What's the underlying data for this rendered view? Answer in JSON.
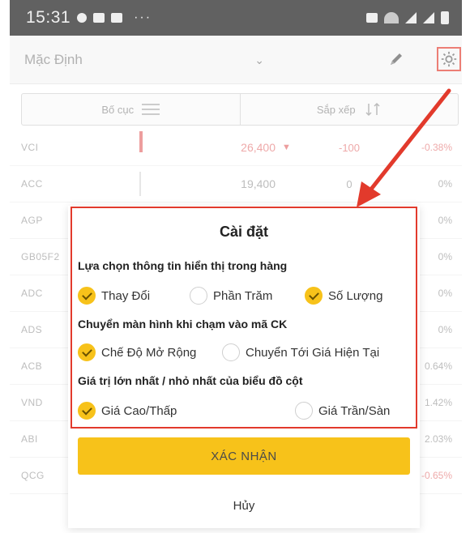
{
  "status_bar": {
    "time": "15:31",
    "more": "···"
  },
  "topbar": {
    "watchlist_value": "Mặc Định"
  },
  "segment": {
    "layout_label": "Bố cục",
    "sort_label": "Sắp xếp"
  },
  "stocks": [
    {
      "symbol": "VCI",
      "price": "26,400",
      "change": "-100",
      "pct": "-0.38%",
      "dir": "down"
    },
    {
      "symbol": "ACC",
      "price": "19,400",
      "change": "0",
      "pct": "0%",
      "dir": "flat"
    },
    {
      "symbol": "AGP",
      "price": "",
      "change": "",
      "pct": "0%",
      "dir": "flat"
    },
    {
      "symbol": "GB05F2",
      "price": "",
      "change": "",
      "pct": "0%",
      "dir": "flat"
    },
    {
      "symbol": "ADC",
      "price": "",
      "change": "",
      "pct": "0%",
      "dir": "flat"
    },
    {
      "symbol": "ADS",
      "price": "",
      "change": "",
      "pct": "0%",
      "dir": "flat"
    },
    {
      "symbol": "ACB",
      "price": "",
      "change": "",
      "pct": "0.64%",
      "dir": "flat"
    },
    {
      "symbol": "VND",
      "price": "",
      "change": "",
      "pct": "1.42%",
      "dir": "flat"
    },
    {
      "symbol": "ABI",
      "price": "",
      "change": "",
      "pct": "2.03%",
      "dir": "flat"
    },
    {
      "symbol": "QCG",
      "price": "",
      "change": "",
      "pct": "-0.65%",
      "dir": "down"
    }
  ],
  "dialog": {
    "title": "Cài đặt",
    "section1": {
      "heading": "Lựa chọn thông tin hiển thị trong hàng",
      "options": [
        {
          "label": "Thay Đổi",
          "checked": true
        },
        {
          "label": "Phần Trăm",
          "checked": false
        },
        {
          "label": "Số Lượng",
          "checked": true
        }
      ]
    },
    "section2": {
      "heading": "Chuyển màn hình khi chạm vào mã CK",
      "options": [
        {
          "label": "Chế Độ Mở Rộng",
          "checked": true
        },
        {
          "label": "Chuyển Tới Giá Hiện Tại",
          "checked": false
        }
      ]
    },
    "section3": {
      "heading": "Giá trị lớn nhất / nhỏ nhất của biểu đồ cột",
      "options": [
        {
          "label": "Giá Cao/Thấp",
          "checked": true
        },
        {
          "label": "Giá Trần/Sàn",
          "checked": false
        }
      ]
    },
    "confirm_label": "XÁC NHẬN",
    "cancel_label": "Hủy"
  },
  "colors": {
    "accent": "#f7c21a",
    "annotation": "#e23a2c",
    "down": "#e57b7b"
  },
  "icons": {
    "edit": "pencil-icon",
    "settings": "gear-icon",
    "layout": "list-icon",
    "sort": "sort-icon",
    "dropdown": "chevron-down-icon"
  }
}
